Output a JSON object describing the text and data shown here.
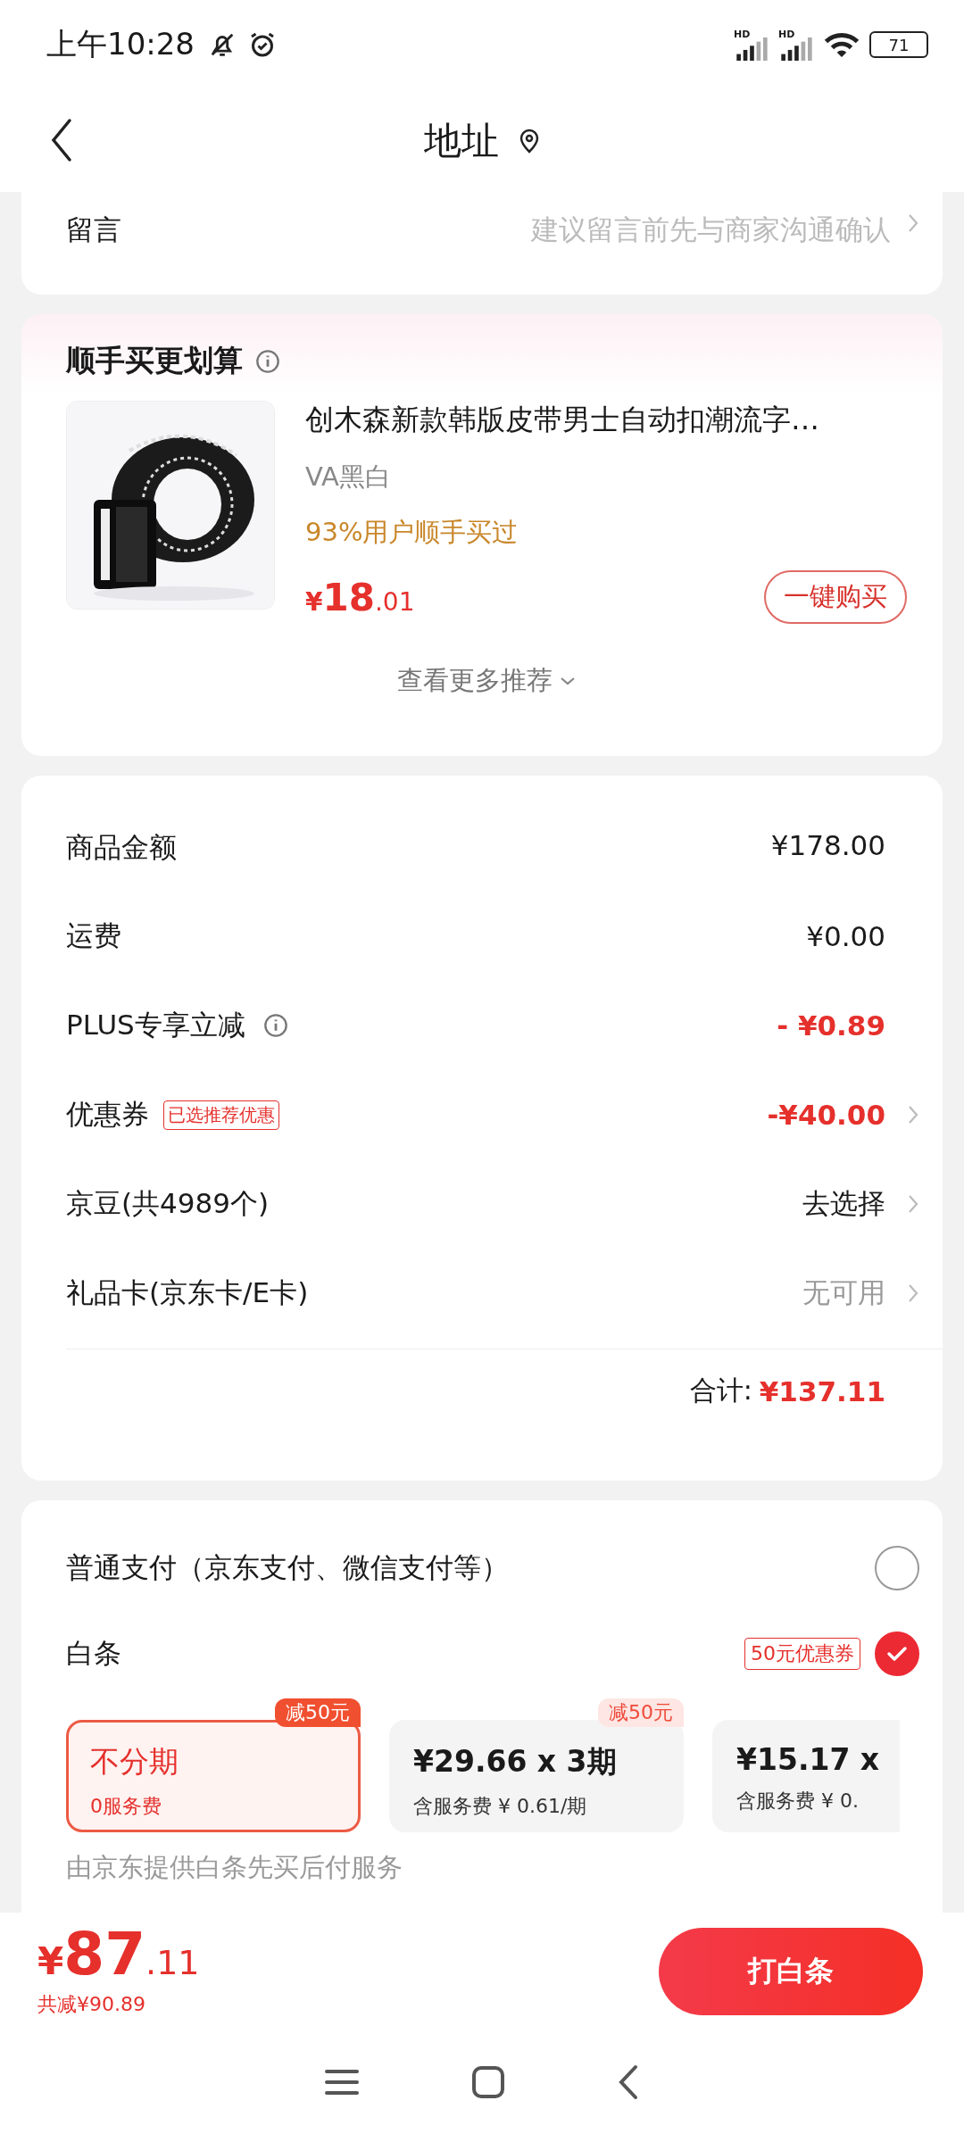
{
  "status_bar": {
    "time": "上午10:28",
    "network": [
      "HD",
      "HD"
    ],
    "battery": "71"
  },
  "header": {
    "title": "地址"
  },
  "message": {
    "label": "留言",
    "placeholder": "建议留言前先与商家沟通确认"
  },
  "recommend": {
    "title": "顺手买更划算",
    "product": {
      "name": "创木森新款韩版皮带男士自动扣潮流字…",
      "variant": "VA黑白",
      "social": "93%用户顺手买过",
      "price_yen": "¥",
      "price_int": "18",
      "price_dec": ".01",
      "buy": "一键购买"
    },
    "more": "查看更多推荐"
  },
  "costs": {
    "rows": [
      {
        "label": "商品金额",
        "value": "¥178.00",
        "kind": "normal"
      },
      {
        "label": "运费",
        "value": "¥0.00",
        "kind": "normal"
      },
      {
        "label": "PLUS专享立减",
        "info": true,
        "value": "- ¥0.89",
        "kind": "discount"
      },
      {
        "label": "优惠券",
        "tag": "已选推荐优惠",
        "value": "-¥40.00",
        "kind": "discount",
        "arrow": true
      },
      {
        "label": "京豆(共4989个)",
        "value": "去选择",
        "kind": "normal",
        "arrow": true
      },
      {
        "label": "礼品卡(京东卡/E卡)",
        "value": "无可用",
        "kind": "muted",
        "arrow": true
      }
    ],
    "total_label": "合计:",
    "total": "¥137.11"
  },
  "payment": {
    "methods": [
      {
        "label": "普通支付（京东支付、微信支付等）",
        "selected": false
      },
      {
        "label": "白条",
        "tag": "50元优惠券",
        "selected": true
      }
    ],
    "plans": [
      {
        "title": "不分期",
        "sub": "0服务费",
        "badge": "减50元",
        "selected": true
      },
      {
        "title": "¥29.66 x 3期",
        "sub": "含服务费 ¥ 0.61/期",
        "badge": "减50元",
        "selected": false
      },
      {
        "title": "¥15.17 x",
        "sub": "含服务费 ¥ 0.",
        "selected": false
      }
    ],
    "note": "由京东提供白条先买后付服务"
  },
  "checkout": {
    "yen": "¥",
    "int": "87",
    "dec": ".11",
    "saved": "共减¥90.89",
    "button": "打白条"
  }
}
